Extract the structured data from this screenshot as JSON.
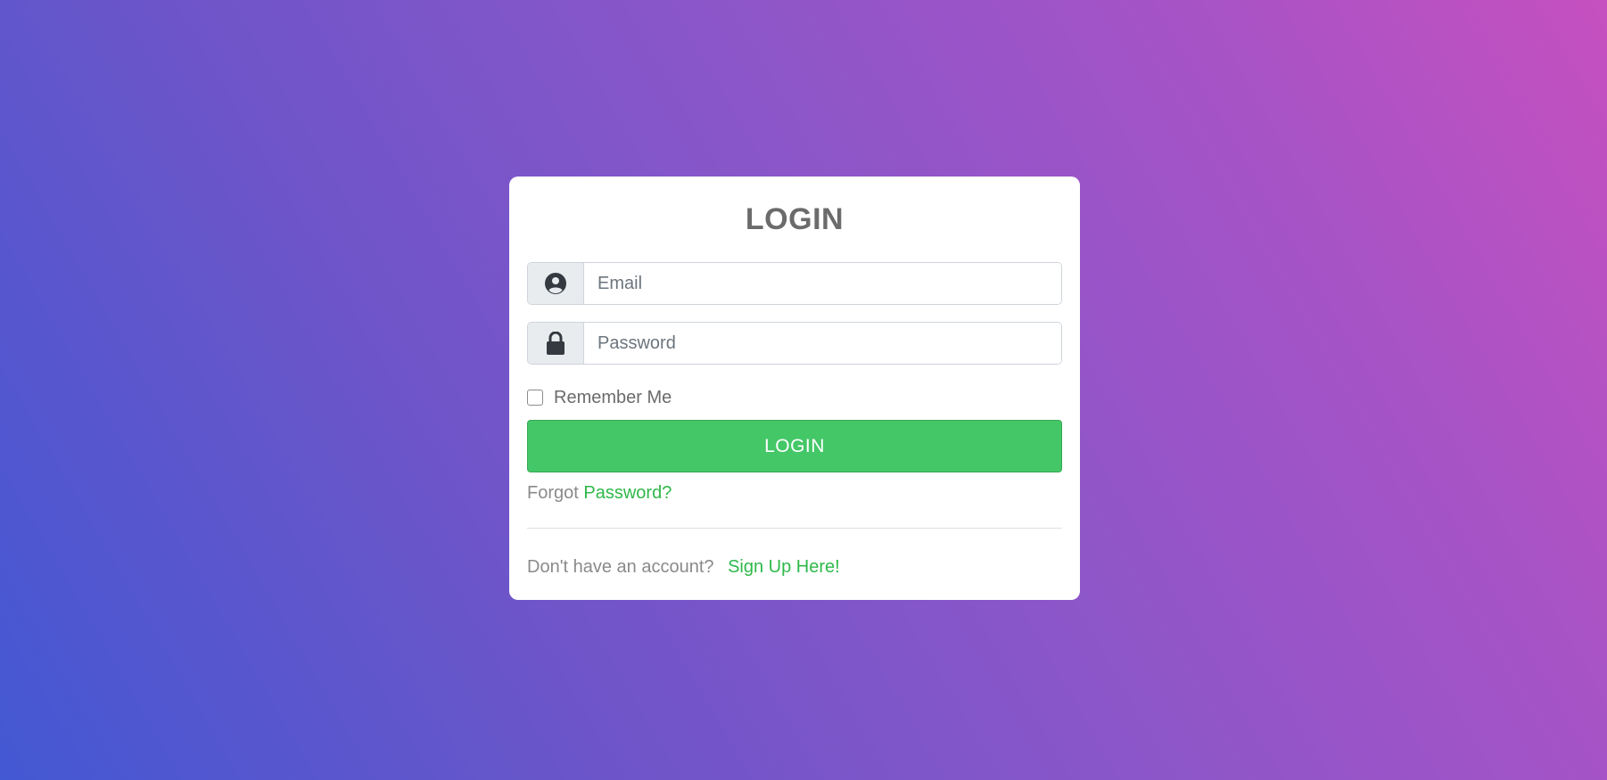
{
  "login_card": {
    "title": "LOGIN",
    "email": {
      "placeholder": "Email",
      "icon": "user-circle-icon"
    },
    "password": {
      "placeholder": "Password",
      "icon": "lock-icon"
    },
    "remember_label": "Remember Me",
    "remember_checked": false,
    "login_button_label": "LOGIN",
    "forgot_prefix": "Forgot",
    "forgot_link": "Password?",
    "signup_prefix": "Don't have an account?",
    "signup_link": "Sign Up Here!"
  },
  "colors": {
    "gradient_start": "#4358d3",
    "gradient_end": "#c650bf",
    "button_green": "#44c767",
    "link_green": "#2fb84a",
    "title_gray": "#6b6b6b"
  }
}
